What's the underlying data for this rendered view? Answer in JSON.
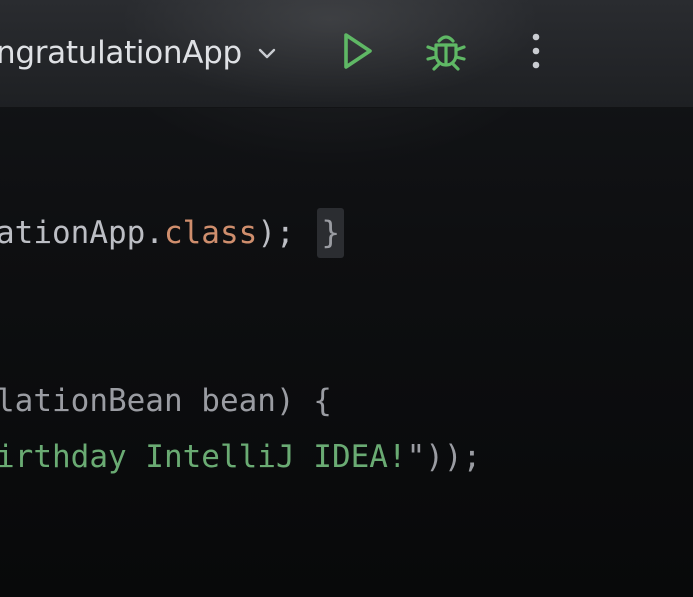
{
  "toolbar": {
    "run_config_name": "ngratulationApp",
    "icons": {
      "dropdown": "chevron-down-icon",
      "run": "play-icon",
      "debug": "bug-icon",
      "more": "more-vertical-icon"
    },
    "colors": {
      "run": "#5fb865",
      "debug": "#5fb865",
      "text": "#dfe1e5"
    }
  },
  "editor": {
    "lines": [
      {
        "tokens": [
          {
            "text": "ationApp.",
            "kind": "plain"
          },
          {
            "text": "class",
            "kind": "keyword"
          },
          {
            "text": "); ",
            "kind": "plain"
          }
        ],
        "fold_marker": "}"
      },
      {
        "tokens": [
          {
            "text": "lationBean bean) {",
            "kind": "dim"
          }
        ]
      },
      {
        "tokens": [
          {
            "text": "irthday IntelliJ IDEA!",
            "kind": "string"
          },
          {
            "text": "\"));",
            "kind": "dim"
          }
        ]
      }
    ],
    "colors": {
      "plain": "#bcbec4",
      "keyword": "#cf8e6d",
      "string": "#6aab73"
    }
  }
}
